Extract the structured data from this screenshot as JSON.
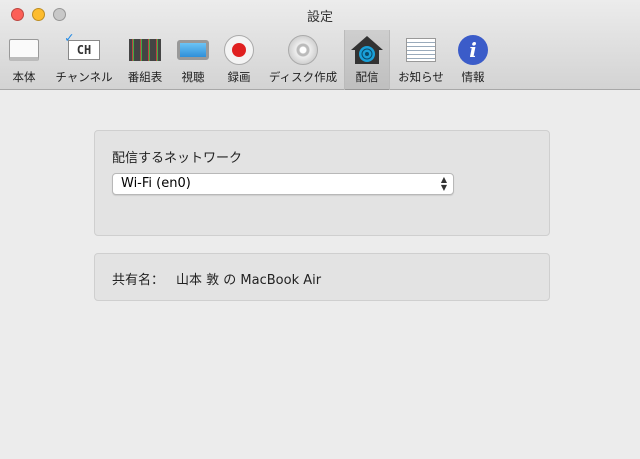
{
  "window": {
    "title": "設定"
  },
  "toolbar": [
    {
      "label": "本体",
      "icon": "device-icon"
    },
    {
      "label": "チャンネル",
      "icon": "channel-icon"
    },
    {
      "label": "番組表",
      "icon": "program-guide-icon"
    },
    {
      "label": "視聴",
      "icon": "tv-icon"
    },
    {
      "label": "録画",
      "icon": "record-icon"
    },
    {
      "label": "ディスク作成",
      "icon": "disc-icon"
    },
    {
      "label": "配信",
      "icon": "home-broadcast-icon",
      "selected": true
    },
    {
      "label": "お知らせ",
      "icon": "notice-icon"
    },
    {
      "label": "情報",
      "icon": "info-icon"
    }
  ],
  "network": {
    "label": "配信するネットワーク",
    "selected": "Wi-Fi (en0)"
  },
  "share": {
    "label": "共有名：",
    "value": "山本 敦 の MacBook Air"
  },
  "colors": {
    "record": "#e02020",
    "info": "#3b5cc9",
    "selected_bg": "#cfcfcf"
  }
}
